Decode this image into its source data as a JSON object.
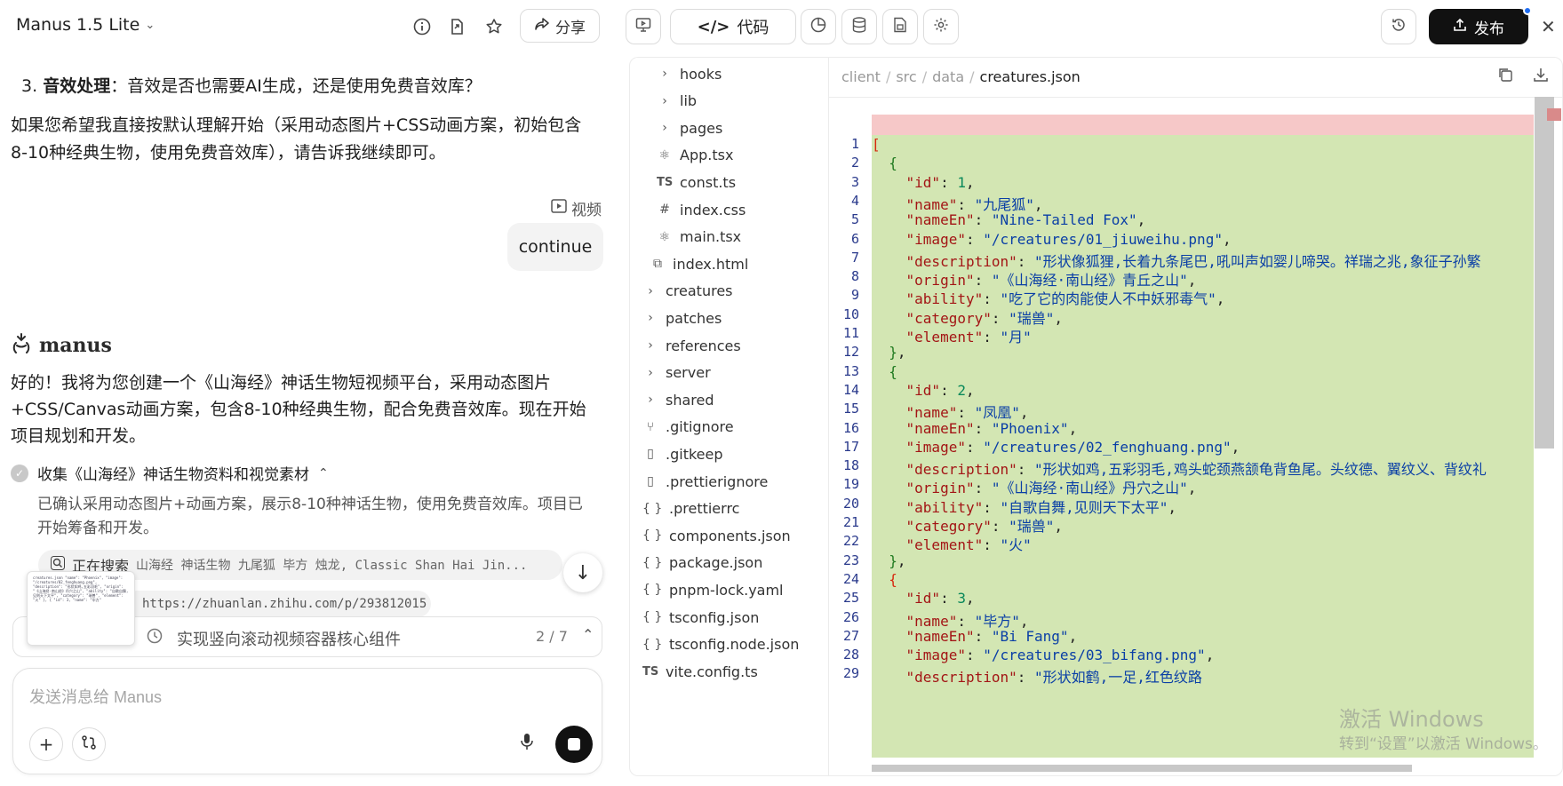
{
  "header_left": {
    "model_name": "Manus 1.5 Lite",
    "share_label": "分享"
  },
  "chat": {
    "clipped_line": "· · ·",
    "numbered_item_number": "3.",
    "numbered_item_bold": "音效处理",
    "numbered_item_text": "：音效是否也需要AI生成，还是使用免费音效库？",
    "paragraph_1": "如果您希望我直接按默认理解开始（采用动态图片+CSS动画方案，初始包含8-10种经典生物，使用免费音效库），请告诉我继续即可。",
    "video_tag": "视频",
    "user_message": "continue",
    "agent_name": "manus",
    "paragraph_2": "好的！我将为您创建一个《山海经》神话生物短视频平台，采用动态图片+CSS/Canvas动画方案，包含8-10种经典生物，配合免费音效库。现在开始项目规划和开发。",
    "step_title": "收集《山海经》神话生物资料和视觉素材",
    "step_description": "已确认采用动态图片+动画方案，展示8-10种神话生物，使用免费音效库。项目已开始筹备和开发。",
    "search_label": "正在搜索",
    "search_query": "山海经 神话生物 九尾狐 毕方 烛龙, Classic Shan Hai Jin...",
    "url": "https://zhuanlan.zhihu.com/p/293812015",
    "thumb_text": "creatures.json  \"name\": \"Phoenix\", \"image\": \"/creatures/02_fenghuang.png\", \"description\": \"形状如鸡,五彩羽毛\", \"origin\": \"《山海经·南山经》丹穴之山\", \"ability\": \"自歌自舞,见则天下太平\", \"category\": \"瑞兽\", \"element\": \"火\" }, { \"id\": 3, \"name\": \"毕方\""
  },
  "task_bar": {
    "label": "实现竖向滚动视频容器核心组件",
    "progress": "2 / 7"
  },
  "composer": {
    "placeholder": "发送消息给 Manus"
  },
  "header_right": {
    "code_tab_label": "代码",
    "publish_label": "发布"
  },
  "file_tree": [
    {
      "name": "hooks",
      "type": "folder",
      "indent": 1
    },
    {
      "name": "lib",
      "type": "folder",
      "indent": 1
    },
    {
      "name": "pages",
      "type": "folder",
      "indent": 1
    },
    {
      "name": "App.tsx",
      "type": "react",
      "indent": 1
    },
    {
      "name": "const.ts",
      "type": "ts",
      "indent": 1
    },
    {
      "name": "index.css",
      "type": "css",
      "indent": 1
    },
    {
      "name": "main.tsx",
      "type": "react",
      "indent": 1
    },
    {
      "name": "index.html",
      "type": "html",
      "indent": 0.5
    },
    {
      "name": "creatures",
      "type": "folder",
      "indent": 0
    },
    {
      "name": "patches",
      "type": "folder",
      "indent": 0
    },
    {
      "name": "references",
      "type": "folder",
      "indent": 0
    },
    {
      "name": "server",
      "type": "folder",
      "indent": 0
    },
    {
      "name": "shared",
      "type": "folder",
      "indent": 0
    },
    {
      "name": ".gitignore",
      "type": "git",
      "indent": 0
    },
    {
      "name": ".gitkeep",
      "type": "file",
      "indent": 0
    },
    {
      "name": ".prettierignore",
      "type": "file",
      "indent": 0
    },
    {
      "name": ".prettierrc",
      "type": "json",
      "indent": 0
    },
    {
      "name": "components.json",
      "type": "json",
      "indent": 0
    },
    {
      "name": "package.json",
      "type": "json",
      "indent": 0
    },
    {
      "name": "pnpm-lock.yaml",
      "type": "json",
      "indent": 0
    },
    {
      "name": "tsconfig.json",
      "type": "json",
      "indent": 0
    },
    {
      "name": "tsconfig.node.json",
      "type": "json",
      "indent": 0
    },
    {
      "name": "vite.config.ts",
      "type": "ts",
      "indent": 0
    }
  ],
  "breadcrumb": [
    "client",
    "src",
    "data",
    "creatures.json"
  ],
  "code_lines": [
    [
      [
        "br1",
        "["
      ]
    ],
    [
      [
        "p",
        "  "
      ],
      [
        "br2",
        "{"
      ]
    ],
    [
      [
        "p",
        "    "
      ],
      [
        "k",
        "\"id\""
      ],
      [
        "p",
        ": "
      ],
      [
        "n",
        "1"
      ],
      [
        "p",
        ","
      ]
    ],
    [
      [
        "p",
        "    "
      ],
      [
        "k",
        "\"name\""
      ],
      [
        "p",
        ": "
      ],
      [
        "s",
        "\"九尾狐\""
      ],
      [
        "p",
        ","
      ]
    ],
    [
      [
        "p",
        "    "
      ],
      [
        "k",
        "\"nameEn\""
      ],
      [
        "p",
        ": "
      ],
      [
        "s",
        "\"Nine-Tailed Fox\""
      ],
      [
        "p",
        ","
      ]
    ],
    [
      [
        "p",
        "    "
      ],
      [
        "k",
        "\"image\""
      ],
      [
        "p",
        ": "
      ],
      [
        "s",
        "\"/creatures/01_jiuweihu.png\""
      ],
      [
        "p",
        ","
      ]
    ],
    [
      [
        "p",
        "    "
      ],
      [
        "k",
        "\"description\""
      ],
      [
        "p",
        ": "
      ],
      [
        "s",
        "\"形状像狐狸,长着九条尾巴,吼叫声如婴儿啼哭。祥瑞之兆,象征子孙繁"
      ]
    ],
    [
      [
        "p",
        "    "
      ],
      [
        "k",
        "\"origin\""
      ],
      [
        "p",
        ": "
      ],
      [
        "s",
        "\"《山海经·南山经》青丘之山\""
      ],
      [
        "p",
        ","
      ]
    ],
    [
      [
        "p",
        "    "
      ],
      [
        "k",
        "\"ability\""
      ],
      [
        "p",
        ": "
      ],
      [
        "s",
        "\"吃了它的肉能使人不中妖邪毒气\""
      ],
      [
        "p",
        ","
      ]
    ],
    [
      [
        "p",
        "    "
      ],
      [
        "k",
        "\"category\""
      ],
      [
        "p",
        ": "
      ],
      [
        "s",
        "\"瑞兽\""
      ],
      [
        "p",
        ","
      ]
    ],
    [
      [
        "p",
        "    "
      ],
      [
        "k",
        "\"element\""
      ],
      [
        "p",
        ": "
      ],
      [
        "s",
        "\"月\""
      ]
    ],
    [
      [
        "p",
        "  "
      ],
      [
        "br2",
        "}"
      ],
      [
        "p",
        ","
      ]
    ],
    [
      [
        "p",
        "  "
      ],
      [
        "br2",
        "{"
      ]
    ],
    [
      [
        "p",
        "    "
      ],
      [
        "k",
        "\"id\""
      ],
      [
        "p",
        ": "
      ],
      [
        "n",
        "2"
      ],
      [
        "p",
        ","
      ]
    ],
    [
      [
        "p",
        "    "
      ],
      [
        "k",
        "\"name\""
      ],
      [
        "p",
        ": "
      ],
      [
        "s",
        "\"凤凰\""
      ],
      [
        "p",
        ","
      ]
    ],
    [
      [
        "p",
        "    "
      ],
      [
        "k",
        "\"nameEn\""
      ],
      [
        "p",
        ": "
      ],
      [
        "s",
        "\"Phoenix\""
      ],
      [
        "p",
        ","
      ]
    ],
    [
      [
        "p",
        "    "
      ],
      [
        "k",
        "\"image\""
      ],
      [
        "p",
        ": "
      ],
      [
        "s",
        "\"/creatures/02_fenghuang.png\""
      ],
      [
        "p",
        ","
      ]
    ],
    [
      [
        "p",
        "    "
      ],
      [
        "k",
        "\"description\""
      ],
      [
        "p",
        ": "
      ],
      [
        "s",
        "\"形状如鸡,五彩羽毛,鸡头蛇颈燕颔龟背鱼尾。头纹德、翼纹义、背纹礼"
      ]
    ],
    [
      [
        "p",
        "    "
      ],
      [
        "k",
        "\"origin\""
      ],
      [
        "p",
        ": "
      ],
      [
        "s",
        "\"《山海经·南山经》丹穴之山\""
      ],
      [
        "p",
        ","
      ]
    ],
    [
      [
        "p",
        "    "
      ],
      [
        "k",
        "\"ability\""
      ],
      [
        "p",
        ": "
      ],
      [
        "s",
        "\"自歌自舞,见则天下太平\""
      ],
      [
        "p",
        ","
      ]
    ],
    [
      [
        "p",
        "    "
      ],
      [
        "k",
        "\"category\""
      ],
      [
        "p",
        ": "
      ],
      [
        "s",
        "\"瑞兽\""
      ],
      [
        "p",
        ","
      ]
    ],
    [
      [
        "p",
        "    "
      ],
      [
        "k",
        "\"element\""
      ],
      [
        "p",
        ": "
      ],
      [
        "s",
        "\"火\""
      ]
    ],
    [
      [
        "p",
        "  "
      ],
      [
        "br2",
        "}"
      ],
      [
        "p",
        ","
      ]
    ],
    [
      [
        "p",
        "  "
      ],
      [
        "br1",
        "{"
      ]
    ],
    [
      [
        "p",
        "    "
      ],
      [
        "k",
        "\"id\""
      ],
      [
        "p",
        ": "
      ],
      [
        "n",
        "3"
      ],
      [
        "p",
        ","
      ]
    ],
    [
      [
        "p",
        "    "
      ],
      [
        "k",
        "\"name\""
      ],
      [
        "p",
        ": "
      ],
      [
        "s",
        "\"毕方\""
      ],
      [
        "p",
        ","
      ]
    ],
    [
      [
        "p",
        "    "
      ],
      [
        "k",
        "\"nameEn\""
      ],
      [
        "p",
        ": "
      ],
      [
        "s",
        "\"Bi Fang\""
      ],
      [
        "p",
        ","
      ]
    ],
    [
      [
        "p",
        "    "
      ],
      [
        "k",
        "\"image\""
      ],
      [
        "p",
        ": "
      ],
      [
        "s",
        "\"/creatures/03_bifang.png\""
      ],
      [
        "p",
        ","
      ]
    ],
    [
      [
        "p",
        "    "
      ],
      [
        "k",
        "\"description\""
      ],
      [
        "p",
        ": "
      ],
      [
        "s",
        "\"形状如鹤,一足,红色纹路"
      ]
    ]
  ],
  "watermark": {
    "line1": "激活 Windows",
    "line2": "转到“设置”以激活 Windows。"
  },
  "colors": {
    "diff_added": "#d3e6b3",
    "diff_removed": "#f6c8c8",
    "publish_bg": "#111111",
    "notification_dot": "#1e6cf0"
  }
}
